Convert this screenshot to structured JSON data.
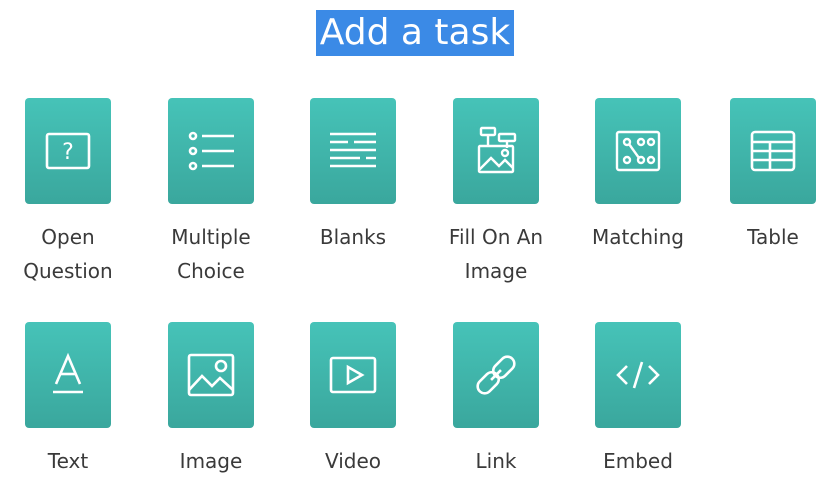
{
  "header": {
    "title": "Add a task"
  },
  "colors": {
    "tile_top": "#46c3b8",
    "tile_bottom": "#3aa79d",
    "title_highlight": "#3b8ae6"
  },
  "tasks": [
    {
      "label": "Open\nQuestion",
      "icon": "question-box-icon"
    },
    {
      "label": "Multiple\nChoice",
      "icon": "list-bullets-icon"
    },
    {
      "label": "Blanks",
      "icon": "text-lines-icon"
    },
    {
      "label": "Fill On An\nImage",
      "icon": "image-tags-icon"
    },
    {
      "label": "Matching",
      "icon": "matching-dots-icon"
    },
    {
      "label": "Table",
      "icon": "table-icon"
    },
    {
      "label": "Text",
      "icon": "text-letter-icon"
    },
    {
      "label": "Image",
      "icon": "picture-icon"
    },
    {
      "label": "Video",
      "icon": "play-video-icon"
    },
    {
      "label": "Link",
      "icon": "chain-link-icon"
    },
    {
      "label": "Embed",
      "icon": "code-brackets-icon"
    }
  ]
}
